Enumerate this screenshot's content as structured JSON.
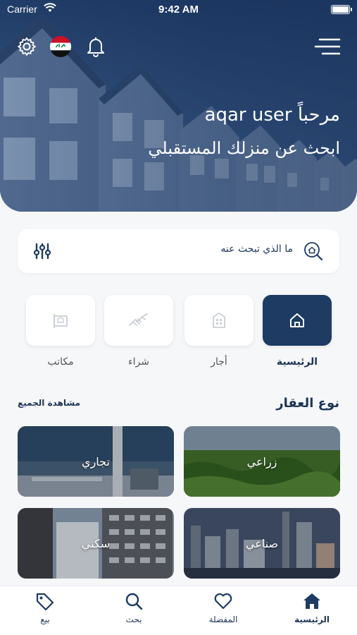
{
  "status_bar": {
    "carrier": "Carrier",
    "time": "9:42 AM"
  },
  "header": {
    "greeting": "مرحباً aqar user",
    "subtitle": "ابحث عن منزلك المستقبلي",
    "icons": [
      "gear-icon",
      "iraq-flag-icon",
      "bell-icon",
      "menu-icon"
    ]
  },
  "search": {
    "placeholder": "ما الذي تبحث عنه"
  },
  "categories": [
    {
      "label": "الرئيسية",
      "icon": "home-icon",
      "active": true
    },
    {
      "label": "أجار",
      "icon": "building-icon",
      "active": false
    },
    {
      "label": "شراء",
      "icon": "handshake-icon",
      "active": false
    },
    {
      "label": "مكاتب",
      "icon": "office-icon",
      "active": false
    }
  ],
  "property_types": {
    "title": "نوع العقار",
    "see_all": "مشاهدة الجميع",
    "items": [
      {
        "label": "زراعي"
      },
      {
        "label": "تجاري"
      },
      {
        "label": "صناعي"
      },
      {
        "label": "سكني"
      }
    ]
  },
  "tabbar": {
    "items": [
      {
        "label": "الرئيسية",
        "icon": "home-icon",
        "active": true
      },
      {
        "label": "المفضلة",
        "icon": "heart-icon",
        "active": false
      },
      {
        "label": "بحث",
        "icon": "search-icon",
        "active": false
      },
      {
        "label": "بيع",
        "icon": "tag-icon",
        "active": false
      }
    ]
  },
  "colors": {
    "primary": "#1d3b63",
    "background": "#f6f7f9",
    "card": "#ffffff"
  }
}
